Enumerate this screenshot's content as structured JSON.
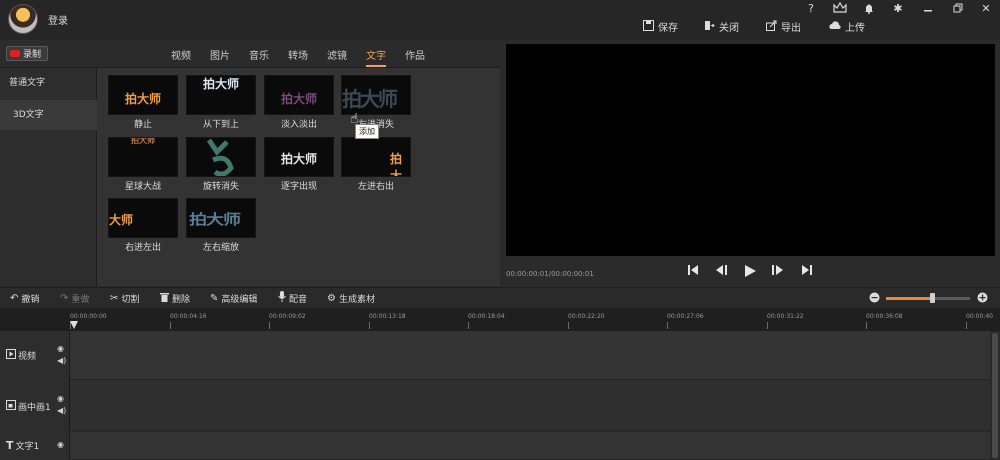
{
  "titlebar": {
    "login": "登录",
    "help": "?",
    "actions": [
      {
        "label": "保存",
        "icon": "save-icon"
      },
      {
        "label": "关闭",
        "icon": "close-project-icon"
      },
      {
        "label": "导出",
        "icon": "export-icon"
      },
      {
        "label": "上传",
        "icon": "upload-icon"
      }
    ]
  },
  "library": {
    "record_label": "录制",
    "tabs": [
      "视频",
      "图片",
      "音乐",
      "转场",
      "滤镜",
      "文字",
      "作品"
    ],
    "active_tab": "文字",
    "categories": [
      "普通文字",
      "3D文字"
    ],
    "thumb_text": "拍大师",
    "thumb_text_fragment": "大师",
    "effects": [
      "静止",
      "从下到上",
      "淡入淡出",
      "左进消失",
      "星球大战",
      "旋转消失",
      "逐字出现",
      "左进右出",
      "右进左出",
      "左右缩放"
    ],
    "tooltip": "添加",
    "accent_color": "#f0a050"
  },
  "preview": {
    "timecode": "00:00:00:01/00:00:00:01"
  },
  "toolbar": {
    "undo": "撤销",
    "redo": "重做",
    "cut": "切割",
    "delete": "删除",
    "advanced": "高级编辑",
    "dub": "配音",
    "generate": "生成素材",
    "zoom_level": 0.55
  },
  "timeline": {
    "ticks": [
      "00:00:00:00",
      "00:00:04:16",
      "00:00:09:02",
      "00:00:13:18",
      "00:00:18:04",
      "00:00:22:20",
      "00:00:27:06",
      "00:00:31:22",
      "00:00:36:08",
      "00:00:40"
    ],
    "tracks": [
      "视频",
      "画中画1",
      "文字1"
    ]
  }
}
